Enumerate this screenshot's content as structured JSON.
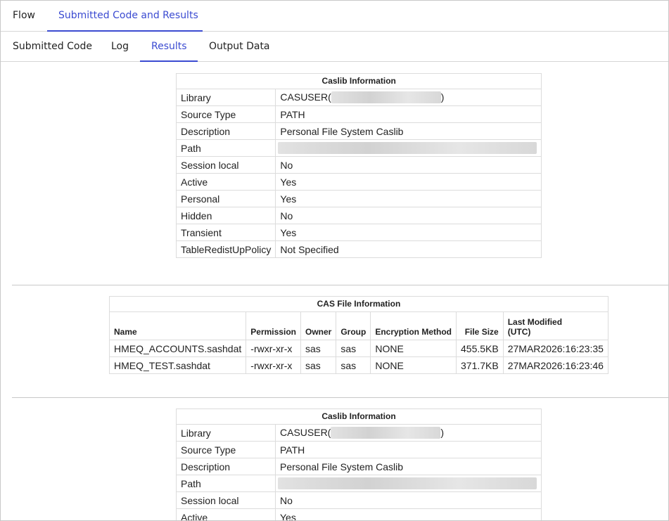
{
  "top_tabs": [
    {
      "label": "Flow",
      "active": false
    },
    {
      "label": "Submitted Code and Results",
      "active": true
    }
  ],
  "sub_tabs": [
    {
      "label": "Submitted Code",
      "active": false
    },
    {
      "label": "Log",
      "active": false
    },
    {
      "label": "Results",
      "active": true
    },
    {
      "label": "Output Data",
      "active": false
    }
  ],
  "caslib1": {
    "title": "Caslib Information",
    "rows": [
      {
        "key": "Library",
        "value_prefix": "CASUSER(",
        "value_suffix": ")"
      },
      {
        "key": "Source Type",
        "value": "PATH"
      },
      {
        "key": "Description",
        "value": "Personal File System Caslib"
      },
      {
        "key": "Path",
        "value": ""
      },
      {
        "key": "Session local",
        "value": "No"
      },
      {
        "key": "Active",
        "value": "Yes"
      },
      {
        "key": "Personal",
        "value": "Yes"
      },
      {
        "key": "Hidden",
        "value": "No"
      },
      {
        "key": "Transient",
        "value": "Yes"
      },
      {
        "key": "TableRedistUpPolicy",
        "value": "Not Specified"
      }
    ]
  },
  "file_info": {
    "title": "CAS File Information",
    "headers": [
      "Name",
      "Permission",
      "Owner",
      "Group",
      "Encryption Method",
      "File Size",
      "Last Modified",
      "(UTC)"
    ],
    "rows": [
      [
        "HMEQ_ACCOUNTS.sashdat",
        "-rwxr-xr-x",
        "sas",
        "sas",
        "NONE",
        "455.5KB",
        "27MAR2026:16:23:35"
      ],
      [
        "HMEQ_TEST.sashdat",
        "-rwxr-xr-x",
        "sas",
        "sas",
        "NONE",
        "371.7KB",
        "27MAR2026:16:23:46"
      ]
    ]
  },
  "caslib2": {
    "title": "Caslib Information",
    "rows": [
      {
        "key": "Library",
        "value_prefix": "CASUSER(",
        "value_suffix": ")"
      },
      {
        "key": "Source Type",
        "value": "PATH"
      },
      {
        "key": "Description",
        "value": "Personal File System Caslib"
      },
      {
        "key": "Path",
        "value": ""
      },
      {
        "key": "Session local",
        "value": "No"
      },
      {
        "key": "Active",
        "value": "Yes"
      }
    ]
  },
  "colors": {
    "accent": "#3b4bd1"
  }
}
